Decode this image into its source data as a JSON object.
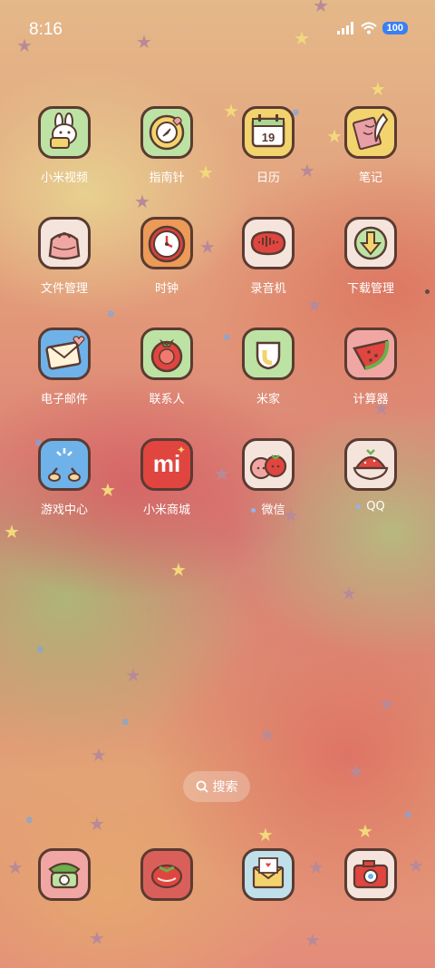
{
  "status_bar": {
    "time": "8:16",
    "battery": "100"
  },
  "apps": [
    {
      "label": "小米视频",
      "icon": "bunny-video-icon"
    },
    {
      "label": "指南针",
      "icon": "compass-icon"
    },
    {
      "label": "日历",
      "icon": "calendar-icon",
      "date": "19"
    },
    {
      "label": "笔记",
      "icon": "notes-quill-icon"
    },
    {
      "label": "文件管理",
      "icon": "file-bag-icon"
    },
    {
      "label": "时钟",
      "icon": "clock-icon"
    },
    {
      "label": "录音机",
      "icon": "recorder-icon"
    },
    {
      "label": "下载管理",
      "icon": "download-icon"
    },
    {
      "label": "电子邮件",
      "icon": "mail-icon"
    },
    {
      "label": "联系人",
      "icon": "tomato-contacts-icon"
    },
    {
      "label": "米家",
      "icon": "mijia-icon"
    },
    {
      "label": "计算器",
      "icon": "watermelon-calculator-icon"
    },
    {
      "label": "游戏中心",
      "icon": "game-center-icon"
    },
    {
      "label": "小米商城",
      "icon": "mi-store-icon",
      "logo_text": "mi"
    },
    {
      "label": "微信",
      "icon": "tomato-friends-wechat-icon"
    },
    {
      "label": "QQ",
      "icon": "strawberry-qq-icon"
    }
  ],
  "search": {
    "label": "搜索"
  },
  "dock": [
    {
      "icon": "telephone-icon"
    },
    {
      "icon": "tomato-gallery-icon"
    },
    {
      "icon": "envelope-heart-icon"
    },
    {
      "icon": "camera-icon"
    }
  ]
}
